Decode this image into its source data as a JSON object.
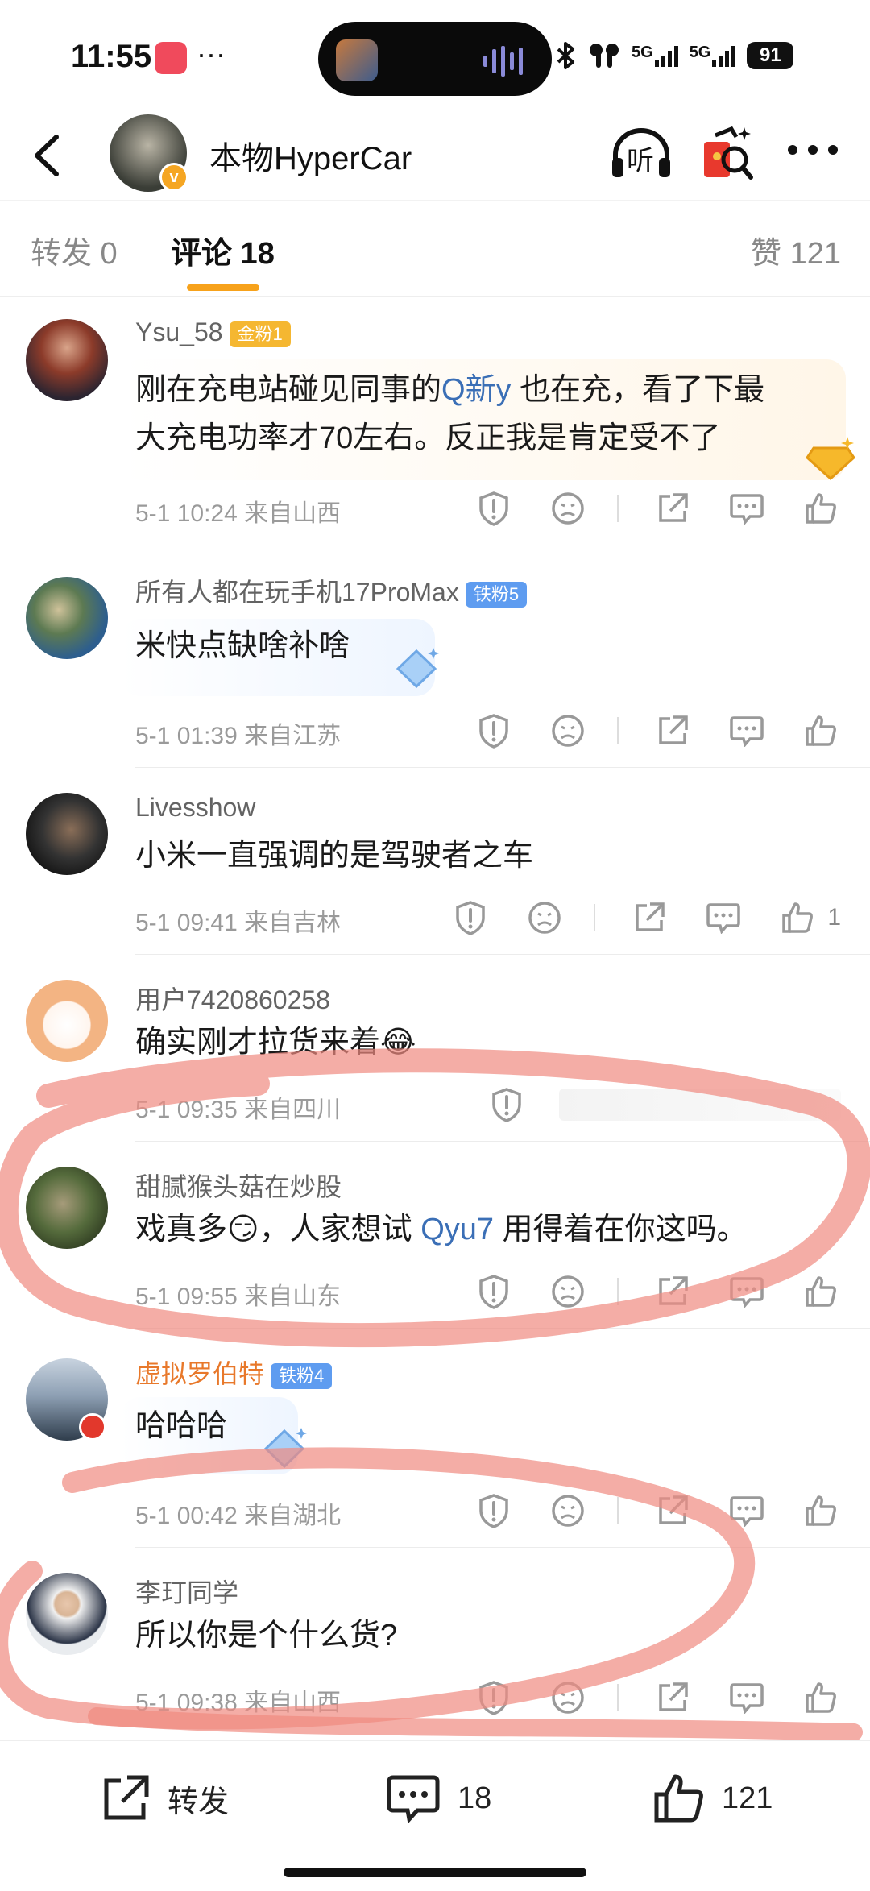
{
  "status_bar": {
    "time": "11:55",
    "dots": "···",
    "signal1": "5G",
    "signal2": "5G",
    "battery": "91"
  },
  "nav": {
    "title": "本物HyperCar",
    "listen_label": "听",
    "verified_mark": "v"
  },
  "tabs": {
    "repost": "转发 0",
    "comments": "评论 18",
    "likes": "赞 121"
  },
  "comments": [
    {
      "user": "Ysu_58",
      "badge": "金粉1",
      "text1_pre": "刚在充电站碰见同事的",
      "text1_link": "Q新y",
      "text1_post": "也在充，看了下最",
      "text2": "大充电功率才70左右。反正我是肯定受不了",
      "meta": "5-1 10:24 来自山西"
    },
    {
      "user": "所有人都在玩手机17ProMax",
      "badge": "铁粉5",
      "text": "米快点缺啥补啥",
      "meta": "5-1 01:39 来自江苏"
    },
    {
      "user": "Livesshow",
      "text": "小米一直强调的是驾驶者之车",
      "meta": "5-1 09:41 来自吉林",
      "likes": "1"
    },
    {
      "user": "用户7420860258",
      "text": "确实刚才拉货来着",
      "emoji": "😂",
      "meta": "5-1 09:35 来自四川"
    },
    {
      "user": "甜腻猴头菇在炒股",
      "text_pre": "戏真多",
      "emoji": "😏",
      "text_mid": "，人家想试 ",
      "text_link": "Qyu7",
      "text_post": " 用得着在你这吗。",
      "meta": "5-1 09:55 来自山东"
    },
    {
      "user": "虚拟罗伯特",
      "badge": "铁粉4",
      "text": "哈哈哈",
      "meta": "5-1 00:42 来自湖北"
    },
    {
      "user": "李玎同学",
      "text": "所以你是个什么货?",
      "meta": "5-1 09:38 来自山西"
    }
  ],
  "bottom_bar": {
    "repost_label": "转发",
    "comment_count": "18",
    "like_count": "121"
  },
  "colors": {
    "accent": "#f7a21b",
    "link": "#3b6fb6",
    "scribble": "#f08a80",
    "gold_badge": "#f5b731",
    "iron_badge": "#5e9cf0"
  }
}
